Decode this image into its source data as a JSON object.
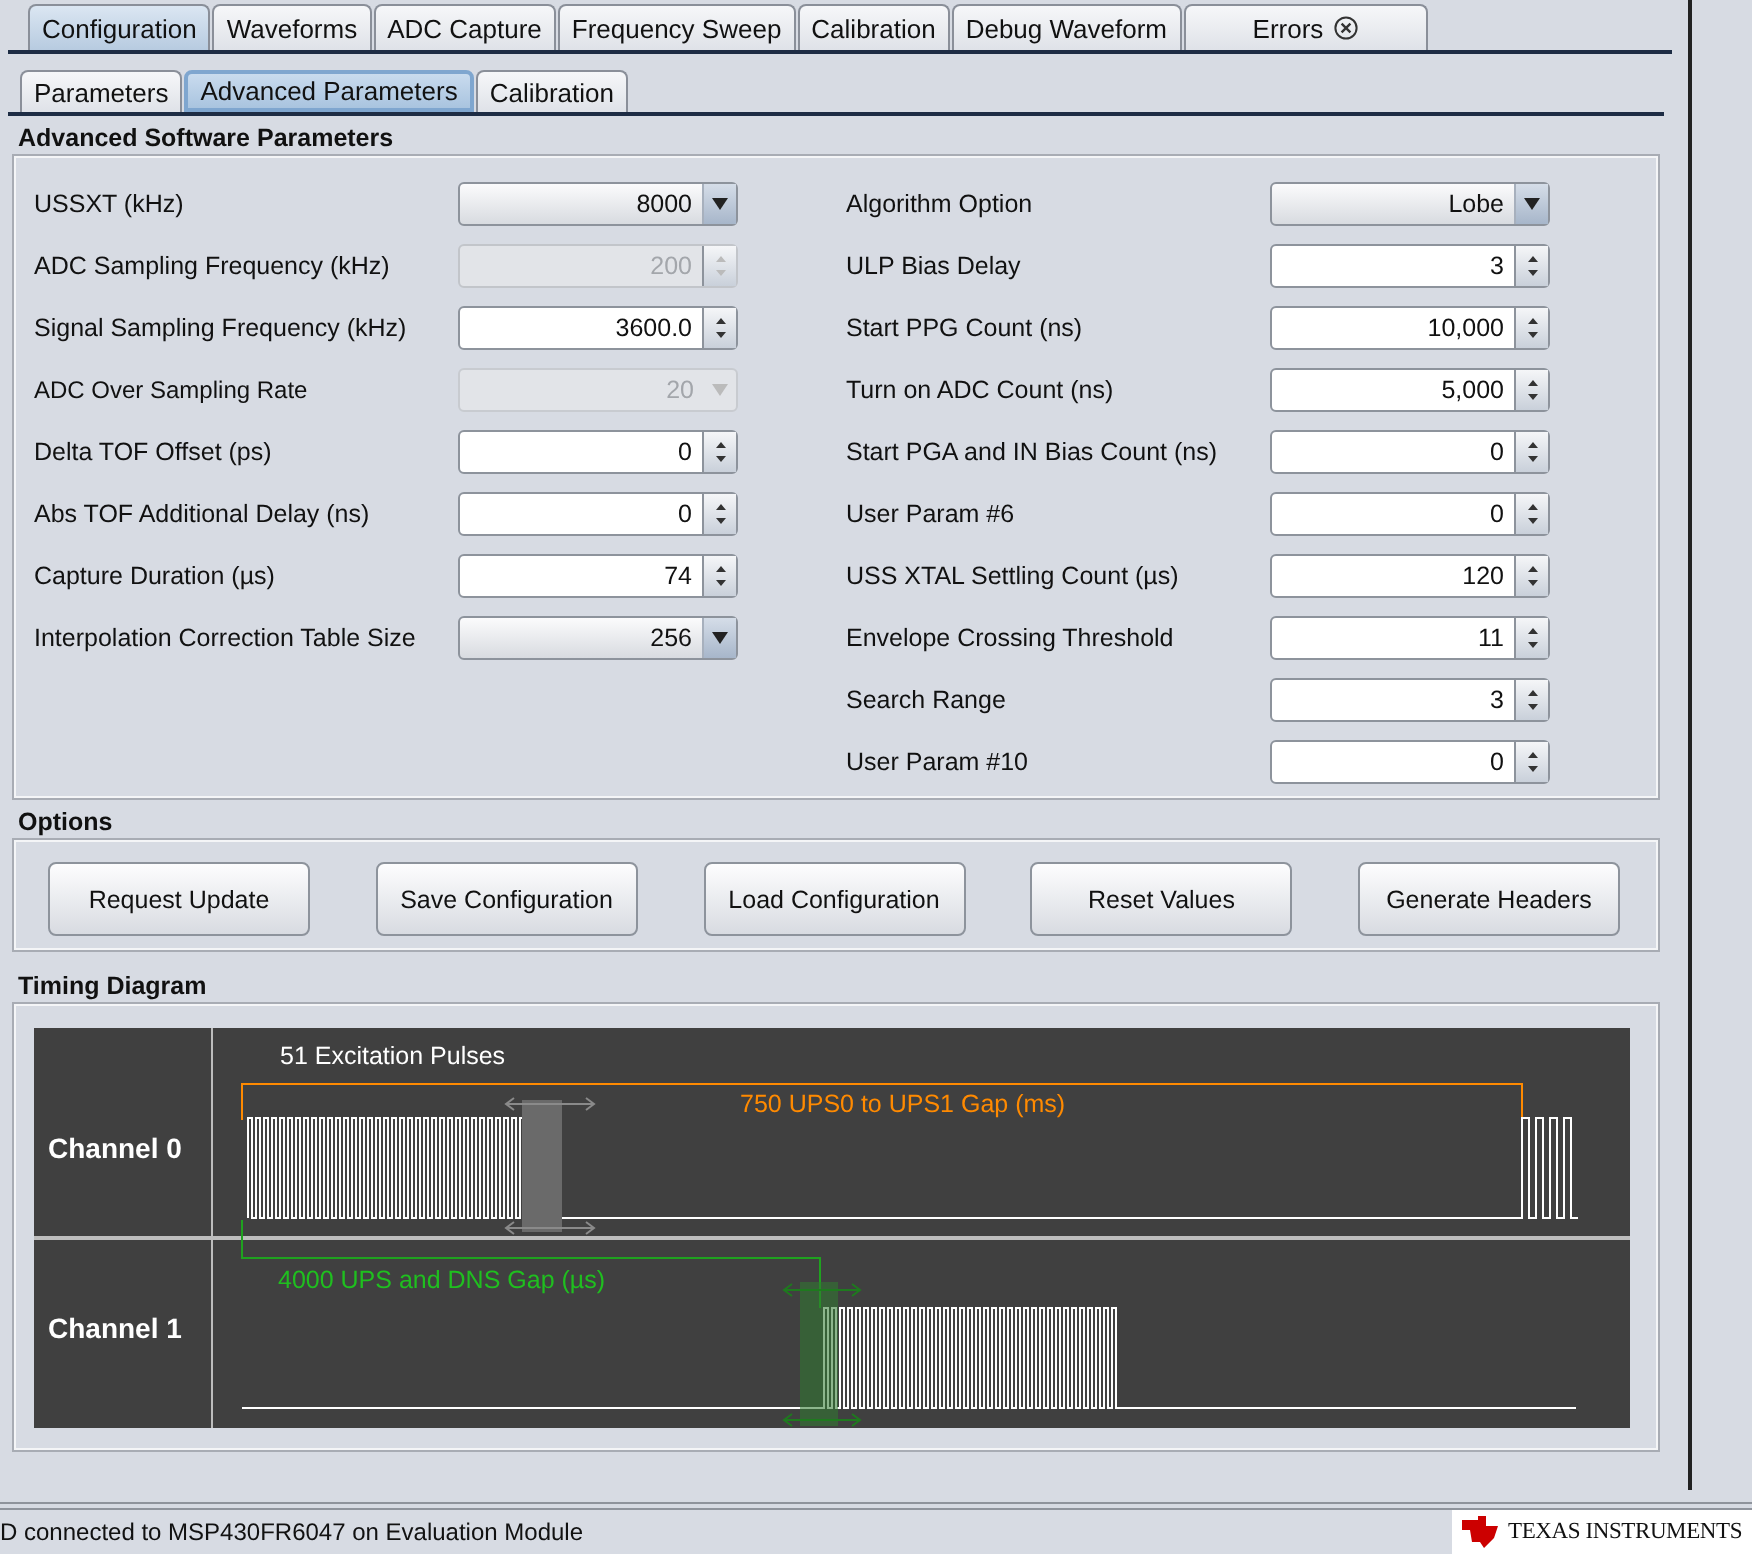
{
  "tabs": [
    {
      "label": "Configuration",
      "selected": true
    },
    {
      "label": "Waveforms",
      "selected": false
    },
    {
      "label": "ADC Capture",
      "selected": false
    },
    {
      "label": "Frequency Sweep",
      "selected": false
    },
    {
      "label": "Calibration",
      "selected": false
    },
    {
      "label": "Debug Waveform",
      "selected": false
    },
    {
      "label": "Errors",
      "selected": false,
      "closable": true
    }
  ],
  "subtabs": [
    {
      "label": "Parameters",
      "selected": false
    },
    {
      "label": "Advanced Parameters",
      "selected": true
    },
    {
      "label": "Calibration",
      "selected": false
    }
  ],
  "advanced": {
    "title": "Advanced Software Parameters",
    "left": [
      {
        "label": "USSXT (kHz)",
        "kind": "dropdown",
        "value": "8000",
        "disabled": false
      },
      {
        "label": "ADC Sampling Frequency (kHz)",
        "kind": "spinner",
        "value": "200",
        "disabled": true
      },
      {
        "label": "Signal Sampling Frequency (kHz)",
        "kind": "spinner",
        "value": "3600.0",
        "disabled": false
      },
      {
        "label": "ADC Over Sampling Rate",
        "kind": "dropdown",
        "value": "20",
        "disabled": true
      },
      {
        "label": "Delta TOF Offset (ps)",
        "kind": "spinner",
        "value": "0",
        "disabled": false
      },
      {
        "label": "Abs TOF Additional Delay (ns)",
        "kind": "spinner",
        "value": "0",
        "disabled": false
      },
      {
        "label": "Capture Duration (µs)",
        "kind": "spinner",
        "value": "74",
        "disabled": false
      },
      {
        "label": "Interpolation Correction Table Size",
        "kind": "dropdown",
        "value": "256",
        "disabled": false
      }
    ],
    "right": [
      {
        "label": "Algorithm Option",
        "kind": "dropdown",
        "value": "Lobe",
        "disabled": false
      },
      {
        "label": "ULP Bias Delay",
        "kind": "spinner",
        "value": "3",
        "disabled": false
      },
      {
        "label": "Start PPG Count (ns)",
        "kind": "spinner",
        "value": "10,000",
        "disabled": false
      },
      {
        "label": "Turn on ADC Count (ns)",
        "kind": "spinner",
        "value": "5,000",
        "disabled": false
      },
      {
        "label": "Start PGA and IN Bias Count (ns)",
        "kind": "spinner",
        "value": "0",
        "disabled": false
      },
      {
        "label": "User Param #6",
        "kind": "spinner",
        "value": "0",
        "disabled": false
      },
      {
        "label": "USS XTAL Settling Count (µs)",
        "kind": "spinner",
        "value": "120",
        "disabled": false
      },
      {
        "label": "Envelope Crossing Threshold",
        "kind": "spinner",
        "value": "11",
        "disabled": false
      },
      {
        "label": "Search Range",
        "kind": "spinner",
        "value": "3",
        "disabled": false
      },
      {
        "label": "User Param #10",
        "kind": "spinner",
        "value": "0",
        "disabled": false
      }
    ]
  },
  "options": {
    "title": "Options",
    "buttons": [
      "Request Update",
      "Save Configuration",
      "Load Configuration",
      "Reset Values",
      "Generate Headers"
    ]
  },
  "timing": {
    "title": "Timing Diagram",
    "channels": [
      "Channel 0",
      "Channel 1"
    ],
    "pulses_label": "51 Excitation Pulses",
    "ups_gap_label": "750 UPS0 to UPS1 Gap (ms)",
    "dns_gap_label": "4000 UPS and DNS Gap (µs)"
  },
  "status_bar": {
    "text": "D connected to MSP430FR6047 on Evaluation Module",
    "logo": "TEXAS INSTRUMENTS"
  }
}
